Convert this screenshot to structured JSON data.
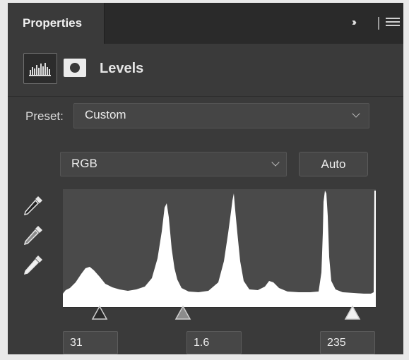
{
  "panel": {
    "tab_label": "Properties",
    "title": "Levels",
    "icons": {
      "adjustment": "levels-histogram-icon",
      "mask": "layer-mask-icon",
      "collapse": "double-chevron-icon",
      "menu": "panel-menu-icon"
    }
  },
  "preset": {
    "label": "Preset:",
    "value": "Custom"
  },
  "channel": {
    "value": "RGB"
  },
  "auto_button": {
    "label": "Auto"
  },
  "eyedroppers": [
    {
      "name": "black-point-eyedropper-icon",
      "fill": "#222222"
    },
    {
      "name": "gray-point-eyedropper-icon",
      "fill": "#8a8a8a"
    },
    {
      "name": "white-point-eyedropper-icon",
      "fill": "#f2f2f2"
    }
  ],
  "histogram": {
    "fill_color": "#ffffff",
    "background_color": "#4a4a4a"
  },
  "input_levels": {
    "black": "31",
    "midtone": "1.6",
    "white": "235"
  },
  "colors": {
    "panel": "#3a3a3a",
    "tabbar": "#2a2a2a",
    "field": "#474747"
  }
}
